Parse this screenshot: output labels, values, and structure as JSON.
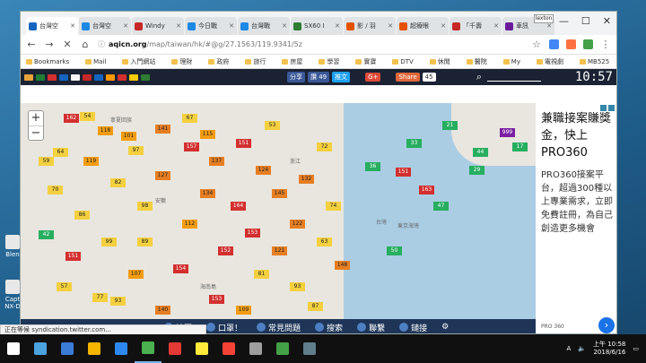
{
  "desktop": {
    "icons": [
      {
        "label": "Blen"
      },
      {
        "label": "Capt NX-D"
      }
    ]
  },
  "tabs": [
    {
      "title": "台灣空",
      "color": "#1565c0"
    },
    {
      "title": "台灣空",
      "color": "#1e88e5"
    },
    {
      "title": "Windy",
      "color": "#c62828"
    },
    {
      "title": "今日戰",
      "color": "#1e88e5"
    },
    {
      "title": "台灣戰",
      "color": "#1e88e5"
    },
    {
      "title": "SX60 I",
      "color": "#2e7d32"
    },
    {
      "title": "影 / 羽",
      "color": "#e65100"
    },
    {
      "title": "超療眼",
      "color": "#e65100"
    },
    {
      "title": "「千壽",
      "color": "#c62828"
    },
    {
      "title": "車訊",
      "color": "#6a1b9a"
    }
  ],
  "profile": "lexton",
  "address": {
    "domain": "aqicn.org",
    "path": "/map/taiwan/hk/#@g/27.1563/119.9341/5z"
  },
  "bookmarks": [
    "Bookmarks",
    "Mail",
    "入門網站",
    "理財",
    "政府",
    "旅行",
    "房屋",
    "學習",
    "實寶",
    "DTV",
    "休閒",
    "醫院",
    "My",
    "電視劇",
    "MB525",
    "其他書籤"
  ],
  "site": {
    "fb_share": "分享",
    "fb_like": "讚 49",
    "tw": "推文",
    "gplus": "G+",
    "share": "Share",
    "share_count": "45",
    "clock": "10:57",
    "flag_colors": [
      "#e8a33a",
      "#1e7e34",
      "#d32f2f",
      "#1565c0",
      "#f5f5f5",
      "#c62828",
      "#1565c0",
      "#ff9800",
      "#d32f2f",
      "#ffcc00",
      "#2e7d32"
    ]
  },
  "map": {
    "zoom_in": "+",
    "zoom_out": "−",
    "labels": [
      "寧夏回族",
      "安徽",
      "浙江",
      "台灣",
      "東京海灣",
      "海南島"
    ],
    "stations": [
      {
        "v": "54",
        "c": "#f4d03f"
      },
      {
        "v": "162",
        "c": "#d32f2f"
      },
      {
        "v": "118",
        "c": "#f39c12"
      },
      {
        "v": "101",
        "c": "#f39c12"
      },
      {
        "v": "141",
        "c": "#e67e22"
      },
      {
        "v": "64",
        "c": "#f4d03f"
      },
      {
        "v": "119",
        "c": "#f39c12"
      },
      {
        "v": "97",
        "c": "#f4d03f"
      },
      {
        "v": "157",
        "c": "#d32f2f"
      },
      {
        "v": "137",
        "c": "#e67e22"
      },
      {
        "v": "151",
        "c": "#d32f2f"
      },
      {
        "v": "124",
        "c": "#e67e22"
      },
      {
        "v": "70",
        "c": "#f4d03f"
      },
      {
        "v": "82",
        "c": "#f4d03f"
      },
      {
        "v": "127",
        "c": "#e67e22"
      },
      {
        "v": "134",
        "c": "#e67e22"
      },
      {
        "v": "164",
        "c": "#d32f2f"
      },
      {
        "v": "145",
        "c": "#e67e22"
      },
      {
        "v": "132",
        "c": "#e67e22"
      },
      {
        "v": "112",
        "c": "#f39c12"
      },
      {
        "v": "98",
        "c": "#f4d03f"
      },
      {
        "v": "86",
        "c": "#f4d03f"
      },
      {
        "v": "153",
        "c": "#d32f2f"
      },
      {
        "v": "122",
        "c": "#e67e22"
      },
      {
        "v": "99",
        "c": "#f4d03f"
      },
      {
        "v": "152",
        "c": "#d32f2f"
      },
      {
        "v": "63",
        "c": "#f4d03f"
      },
      {
        "v": "151",
        "c": "#d32f2f"
      },
      {
        "v": "42",
        "c": "#27ae60"
      },
      {
        "v": "154",
        "c": "#d32f2f"
      },
      {
        "v": "107",
        "c": "#f39c12"
      },
      {
        "v": "81",
        "c": "#f4d03f"
      },
      {
        "v": "93",
        "c": "#f4d03f"
      },
      {
        "v": "57",
        "c": "#f4d03f"
      },
      {
        "v": "77",
        "c": "#f4d03f"
      },
      {
        "v": "153",
        "c": "#d32f2f"
      },
      {
        "v": "140",
        "c": "#e67e22"
      },
      {
        "v": "87",
        "c": "#f4d03f"
      },
      {
        "v": "148",
        "c": "#e67e22"
      },
      {
        "v": "74",
        "c": "#f4d03f"
      },
      {
        "v": "21",
        "c": "#27ae60"
      },
      {
        "v": "36",
        "c": "#27ae60"
      },
      {
        "v": "151",
        "c": "#d32f2f"
      },
      {
        "v": "163",
        "c": "#d32f2f"
      },
      {
        "v": "50",
        "c": "#27ae60"
      },
      {
        "v": "999",
        "c": "#7b1fa2"
      },
      {
        "v": "17",
        "c": "#27ae60"
      },
      {
        "v": "44",
        "c": "#27ae60"
      },
      {
        "v": "53",
        "c": "#f4d03f"
      },
      {
        "v": "67",
        "c": "#f4d03f"
      },
      {
        "v": "93",
        "c": "#f4d03f"
      },
      {
        "v": "109",
        "c": "#f39c12"
      },
      {
        "v": "121",
        "c": "#e67e22"
      },
      {
        "v": "115",
        "c": "#f39c12"
      },
      {
        "v": "59",
        "c": "#f4d03f"
      },
      {
        "v": "72",
        "c": "#f4d03f"
      },
      {
        "v": "33",
        "c": "#27ae60"
      },
      {
        "v": "29",
        "c": "#27ae60"
      },
      {
        "v": "47",
        "c": "#27ae60"
      },
      {
        "v": "89",
        "c": "#f4d03f"
      }
    ]
  },
  "bottom_nav": [
    "地圖",
    "口罩！",
    "常見問題",
    "搜索",
    "聯繫",
    "鏈接"
  ],
  "ad": {
    "headline": "兼職接案賺獎金，快上PRO360",
    "body": "PRO360接案平台，超過300種以上專業需求，立即免費註冊，為自己創造更多機會",
    "footer": "PRO 360",
    "go": "›"
  },
  "status_text": "正在等候 syndication.twitter.com...",
  "taskbar": {
    "icon_colors": [
      "#ffffff",
      "#4aa3df",
      "#3a7bd5",
      "#f4b400",
      "#2d89ef",
      "#4caf50",
      "#e53935",
      "#ffeb3b",
      "#f44336",
      "#9e9e9e",
      "#43a047",
      "#607d8b"
    ],
    "tray": {
      "ime": "A",
      "time": "上午 10:58",
      "date": "2018/6/16"
    }
  }
}
